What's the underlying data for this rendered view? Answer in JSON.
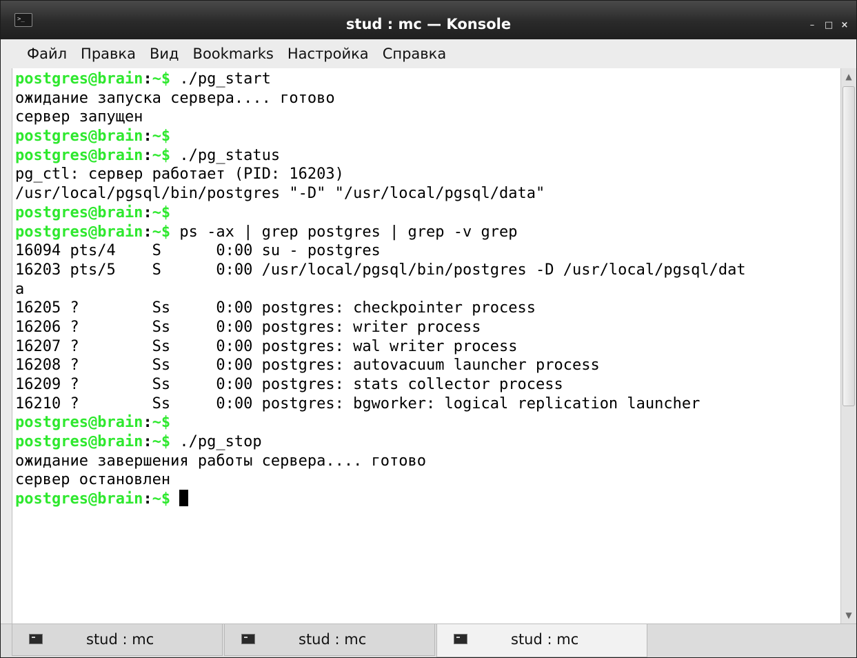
{
  "window": {
    "title": "stud : mc — Konsole",
    "controls": {
      "minimize": "–",
      "maximize": "□",
      "close": "×"
    }
  },
  "menu": [
    {
      "label": "Файл"
    },
    {
      "label": "Правка"
    },
    {
      "label": "Вид"
    },
    {
      "label": "Bookmarks"
    },
    {
      "label": "Настройка"
    },
    {
      "label": "Справка"
    }
  ],
  "prompt": {
    "user_host": "postgres@brain",
    "colon": ":",
    "dir_symbol": "~$"
  },
  "terminal": {
    "lines": [
      {
        "type": "prompt",
        "cmd": " ./pg_start"
      },
      {
        "type": "out",
        "text": "ожидание запуска сервера.... готово"
      },
      {
        "type": "out",
        "text": "сервер запущен"
      },
      {
        "type": "prompt",
        "cmd": ""
      },
      {
        "type": "prompt",
        "cmd": " ./pg_status"
      },
      {
        "type": "out",
        "text": "pg_ctl: сервер работает (PID: 16203)"
      },
      {
        "type": "out",
        "text": "/usr/local/pgsql/bin/postgres \"-D\" \"/usr/local/pgsql/data\""
      },
      {
        "type": "prompt",
        "cmd": ""
      },
      {
        "type": "prompt",
        "cmd": " ps -ax | grep postgres | grep -v grep"
      },
      {
        "type": "out",
        "text": "16094 pts/4    S      0:00 su - postgres"
      },
      {
        "type": "out",
        "text": "16203 pts/5    S      0:00 /usr/local/pgsql/bin/postgres -D /usr/local/pgsql/dat"
      },
      {
        "type": "out",
        "text": "a"
      },
      {
        "type": "out",
        "text": "16205 ?        Ss     0:00 postgres: checkpointer process"
      },
      {
        "type": "out",
        "text": "16206 ?        Ss     0:00 postgres: writer process"
      },
      {
        "type": "out",
        "text": "16207 ?        Ss     0:00 postgres: wal writer process"
      },
      {
        "type": "out",
        "text": "16208 ?        Ss     0:00 postgres: autovacuum launcher process"
      },
      {
        "type": "out",
        "text": "16209 ?        Ss     0:00 postgres: stats collector process"
      },
      {
        "type": "out",
        "text": "16210 ?        Ss     0:00 postgres: bgworker: logical replication launcher"
      },
      {
        "type": "prompt",
        "cmd": ""
      },
      {
        "type": "prompt",
        "cmd": " ./pg_stop"
      },
      {
        "type": "out",
        "text": "ожидание завершения работы сервера.... готово"
      },
      {
        "type": "out",
        "text": "сервер остановлен"
      },
      {
        "type": "prompt",
        "cmd": " ",
        "cursor": true
      }
    ]
  },
  "tabs": [
    {
      "label": "stud : mc",
      "active": false
    },
    {
      "label": "stud : mc",
      "active": false
    },
    {
      "label": "stud : mc",
      "active": true
    }
  ],
  "colors": {
    "prompt": "#2ee82e",
    "titlebar": "#2a2a2a",
    "terminal_bg": "#ffffff"
  }
}
